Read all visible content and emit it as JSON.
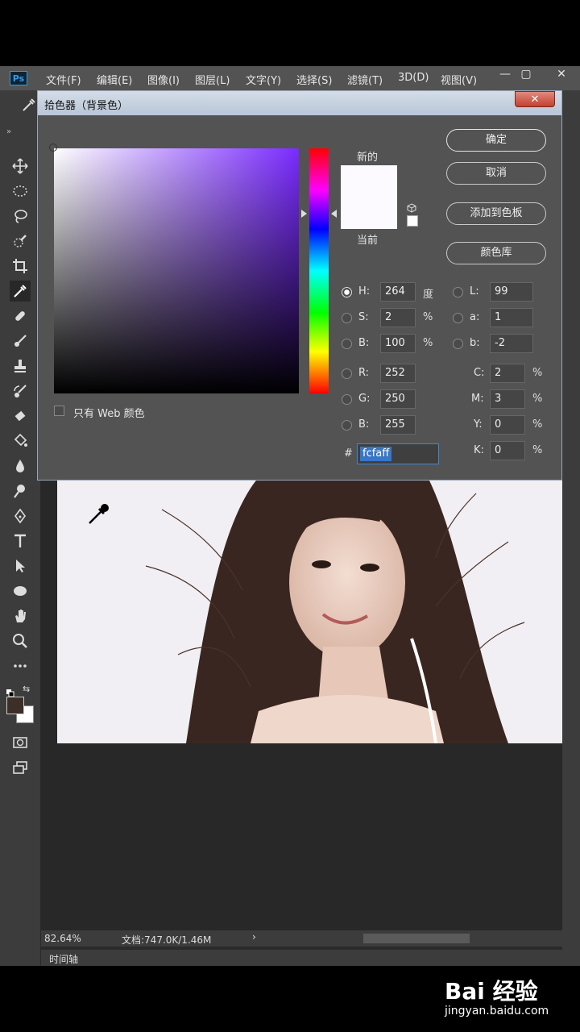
{
  "app": {
    "logo": "Ps",
    "menu": [
      "文件(F)",
      "编辑(E)",
      "图像(I)",
      "图层(L)",
      "文字(Y)",
      "选择(S)",
      "滤镜(T)",
      "3D(D)",
      "视图(V)"
    ],
    "window_controls": [
      "—",
      "▢",
      "✕"
    ]
  },
  "dialog": {
    "title": "拾色器（背景色）",
    "close": "✕",
    "new_label": "新的",
    "current_label": "当前",
    "new_color": "#fcfaff",
    "current_color": "#fcfaff",
    "buttons": {
      "ok": "确定",
      "cancel": "取消",
      "add_swatch": "添加到色板",
      "color_library": "颜色库"
    },
    "web_only_label": "只有 Web 颜色",
    "hsb": [
      {
        "label": "H:",
        "value": "264",
        "unit": "度",
        "selected": true
      },
      {
        "label": "S:",
        "value": "2",
        "unit": "%",
        "selected": false
      },
      {
        "label": "B:",
        "value": "100",
        "unit": "%",
        "selected": false
      }
    ],
    "rgb": [
      {
        "label": "R:",
        "value": "252"
      },
      {
        "label": "G:",
        "value": "250"
      },
      {
        "label": "B:",
        "value": "255"
      }
    ],
    "lab": [
      {
        "label": "L:",
        "value": "99"
      },
      {
        "label": "a:",
        "value": "1"
      },
      {
        "label": "b:",
        "value": "-2"
      }
    ],
    "cmyk": [
      {
        "label": "C:",
        "value": "2",
        "unit": "%"
      },
      {
        "label": "M:",
        "value": "3",
        "unit": "%"
      },
      {
        "label": "Y:",
        "value": "0",
        "unit": "%"
      },
      {
        "label": "K:",
        "value": "0",
        "unit": "%"
      }
    ],
    "hex_label": "#",
    "hex_value": "fcfaff",
    "hue_color": "#7a2bff"
  },
  "status": {
    "zoom": "82.64%",
    "doc": "文档:747.0K/1.46M",
    "arrow": "›"
  },
  "timeline_tab": "时间轴",
  "watermark": {
    "logo": "Bai 经验",
    "url": "jingyan.baidu.com"
  }
}
